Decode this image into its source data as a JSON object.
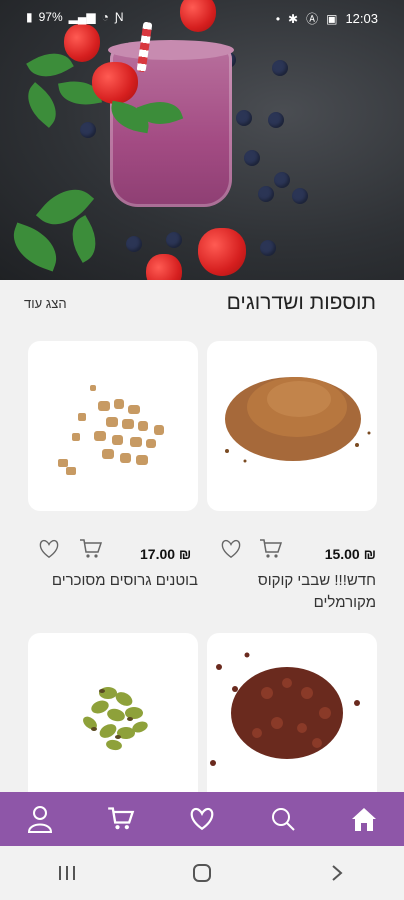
{
  "status_bar": {
    "battery": "97%",
    "time": "12:03"
  },
  "section": {
    "title": "תוספות ושדרוגים",
    "show_more": "הצג עוד"
  },
  "products": [
    {
      "name": "חדש!!! שבבי קוקוס מקורמלים",
      "price": "₪ 15.00"
    },
    {
      "name": "בוטנים גרוסים מסוכרים",
      "price": "₪ 17.00"
    }
  ],
  "icons": {
    "cart": "cart-icon",
    "heart": "heart-icon",
    "nav": [
      "home-icon",
      "search-icon",
      "heart-icon",
      "cart-icon",
      "user-icon"
    ],
    "system": [
      "recents-icon",
      "home-circle-icon",
      "back-chevron-icon"
    ]
  },
  "colors": {
    "nav_bg": "#8e56a8",
    "page_bg": "#f1f1f1"
  }
}
